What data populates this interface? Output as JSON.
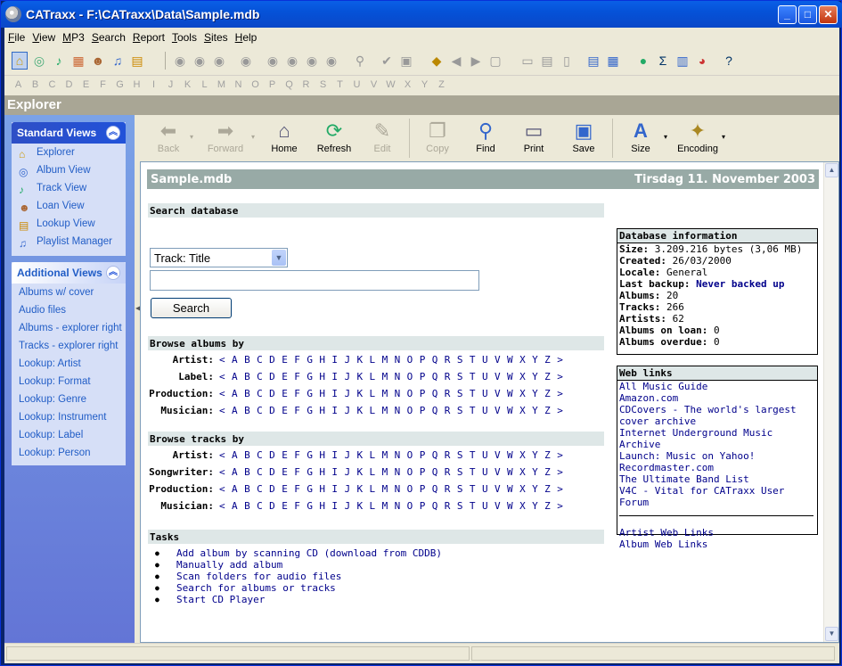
{
  "window": {
    "title": "CATraxx - F:\\CATraxx\\Data\\Sample.mdb"
  },
  "menu": [
    "File",
    "View",
    "MP3",
    "Search",
    "Report",
    "Tools",
    "Sites",
    "Help"
  ],
  "alphabet": [
    "A",
    "B",
    "C",
    "D",
    "E",
    "F",
    "G",
    "H",
    "I",
    "J",
    "K",
    "L",
    "M",
    "N",
    "O",
    "P",
    "Q",
    "R",
    "S",
    "T",
    "U",
    "V",
    "W",
    "X",
    "Y",
    "Z"
  ],
  "header": {
    "title": "Explorer"
  },
  "sidebar": {
    "standard_title": "Standard Views",
    "standard_items": [
      "Explorer",
      "Album View",
      "Track View",
      "Loan View",
      "Lookup View",
      "Playlist Manager"
    ],
    "additional_title": "Additional Views",
    "additional_items": [
      "Albums w/ cover",
      "Audio files",
      "Albums - explorer right",
      "Tracks - explorer right",
      "Lookup: Artist",
      "Lookup: Format",
      "Lookup: Genre",
      "Lookup: Instrument",
      "Lookup: Label",
      "Lookup: Person"
    ]
  },
  "nav": {
    "back": "Back",
    "forward": "Forward",
    "home": "Home",
    "refresh": "Refresh",
    "edit": "Edit",
    "copy": "Copy",
    "find": "Find",
    "print": "Print",
    "save": "Save",
    "size": "Size",
    "encoding": "Encoding"
  },
  "doc": {
    "title": "Sample.mdb",
    "date": "Tirsdag 11. November 2003"
  },
  "search": {
    "heading": "Search database",
    "select_value": "Track: Title",
    "button": "Search"
  },
  "browse_albums": {
    "heading": "Browse albums by",
    "rows": [
      "Artist:",
      "Label:",
      "Production:",
      "Musician:"
    ]
  },
  "browse_tracks": {
    "heading": "Browse tracks by",
    "rows": [
      "Artist:",
      "Songwriter:",
      "Production:",
      "Musician:"
    ]
  },
  "letters": "< A B C D E F G H I J K L M N O P Q R S T U V W X Y Z >",
  "tasks": {
    "heading": "Tasks",
    "items": [
      "Add album by scanning CD (download from CDDB)",
      "Manually add album",
      "Scan folders for audio files",
      "Search for albums or tracks",
      "Start CD Player"
    ]
  },
  "dbinfo": {
    "heading": "Database information",
    "size_label": "Size:",
    "size": "3.209.216 bytes (3,06 MB)",
    "created_label": "Created:",
    "created": "26/03/2000",
    "locale_label": "Locale:",
    "locale": "General",
    "backup_label": "Last backup:",
    "backup": "Never backed up",
    "albums_label": "Albums:",
    "albums": "20",
    "tracks_label": "Tracks:",
    "tracks": "266",
    "artists_label": "Artists:",
    "artists": "62",
    "loan_label": "Albums on loan:",
    "loan": "0",
    "overdue_label": "Albums overdue:",
    "overdue": "0"
  },
  "weblinks": {
    "heading": "Web links",
    "items": [
      "All Music Guide",
      "Amazon.com",
      "CDCovers - The world's largest cover archive",
      "Internet Underground Music Archive",
      "Launch: Music on Yahoo!",
      "Recordmaster.com",
      "The Ultimate Band List",
      "V4C - Vital for CATraxx User Forum"
    ],
    "extra": [
      "Artist Web Links",
      "Album Web Links"
    ]
  }
}
